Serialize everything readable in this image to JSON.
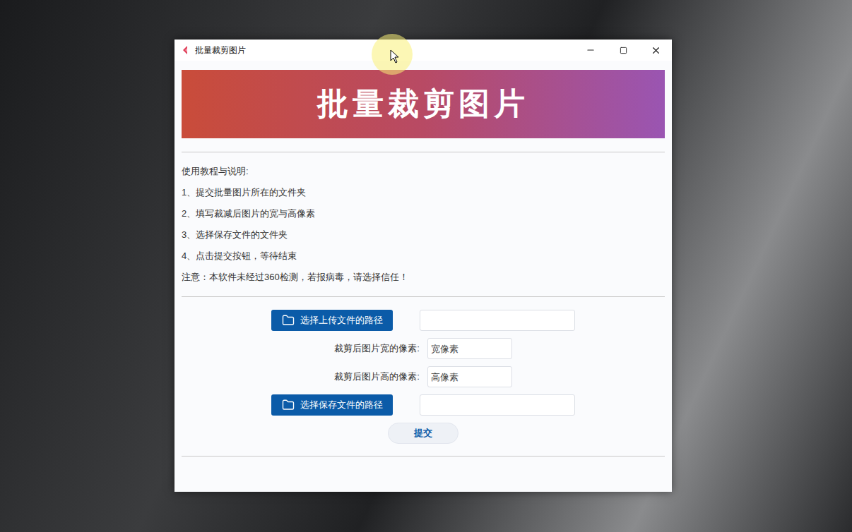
{
  "window": {
    "title": "批量裁剪图片"
  },
  "banner": {
    "title": "批量裁剪图片"
  },
  "instructions": {
    "heading": "使用教程与说明:",
    "steps": [
      "1、提交批量图片所在的文件夹",
      "2、填写裁减后图片的宽与高像素",
      "3、选择保存文件的文件夹",
      "4、点击提交按钮，等待结束"
    ],
    "note": "注意：本软件未经过360检测，若报病毒，请选择信任！"
  },
  "form": {
    "upload_button": "选择上传文件的路径",
    "width_label": "裁剪后图片宽的像素:",
    "width_placeholder": "宽像素",
    "height_label": "裁剪后图片高的像素:",
    "height_placeholder": "高像素",
    "save_button": "选择保存文件的路径",
    "submit": "提交"
  }
}
